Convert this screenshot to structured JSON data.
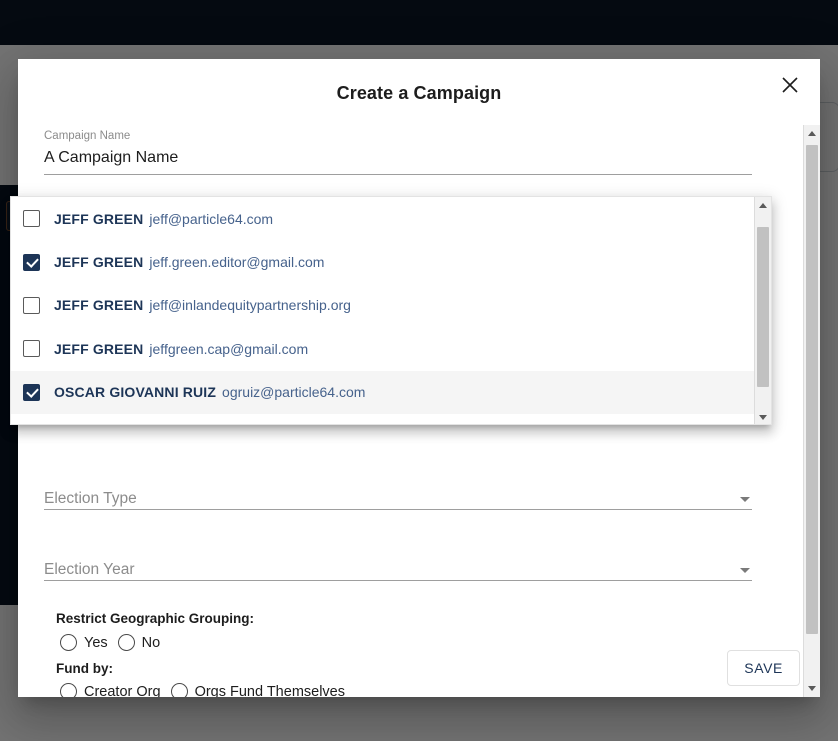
{
  "background": {
    "topbar_color": "#0d1726",
    "cards": [
      "",
      "",
      ""
    ]
  },
  "modal": {
    "title": "Create a Campaign",
    "close_icon": "close-icon",
    "campaign_name": {
      "label": "Campaign Name",
      "value": "A Campaign Name",
      "placeholder": "Campaign Name"
    },
    "election_type": {
      "placeholder": "Election Type",
      "value": "",
      "arrow_icon": "chevron-down-icon"
    },
    "election_year": {
      "placeholder": "Election Year",
      "value": "",
      "arrow_icon": "chevron-down-icon"
    },
    "restrict_geo": {
      "heading": "Restrict Geographic Grouping:",
      "options": [
        {
          "label": "Yes",
          "selected": false
        },
        {
          "label": "No",
          "selected": false
        }
      ]
    },
    "fund_by": {
      "heading": "Fund by:",
      "options": [
        {
          "label": "Creator Org",
          "selected": false
        },
        {
          "label": "Orgs Fund Themselves",
          "selected": false
        }
      ]
    },
    "save_label": "SAVE"
  },
  "dropdown": {
    "items": [
      {
        "name": "JEFF GREEN",
        "email": "jeff@particle64.com",
        "checked": false,
        "highlight": false
      },
      {
        "name": "JEFF GREEN",
        "email": "jeff.green.editor@gmail.com",
        "checked": true,
        "highlight": false
      },
      {
        "name": "JEFF GREEN",
        "email": "jeff@inlandequitypartnership.org",
        "checked": false,
        "highlight": false
      },
      {
        "name": "JEFF GREEN",
        "email": "jeffgreen.cap@gmail.com",
        "checked": false,
        "highlight": false
      },
      {
        "name": "OSCAR GIOVANNI RUIZ",
        "email": "ogruiz@particle64.com",
        "checked": true,
        "highlight": true
      },
      {
        "name": "",
        "email": "",
        "checked": false,
        "highlight": false
      }
    ],
    "scrollbar": {
      "up_icon": "scroll-up-arrow-icon",
      "down_icon": "scroll-down-arrow-icon"
    }
  },
  "colors": {
    "accent_navy": "#1d3557",
    "topbar": "#0d1726",
    "email_blue": "#46628c",
    "placeholder_gray": "#8c8c8c"
  }
}
